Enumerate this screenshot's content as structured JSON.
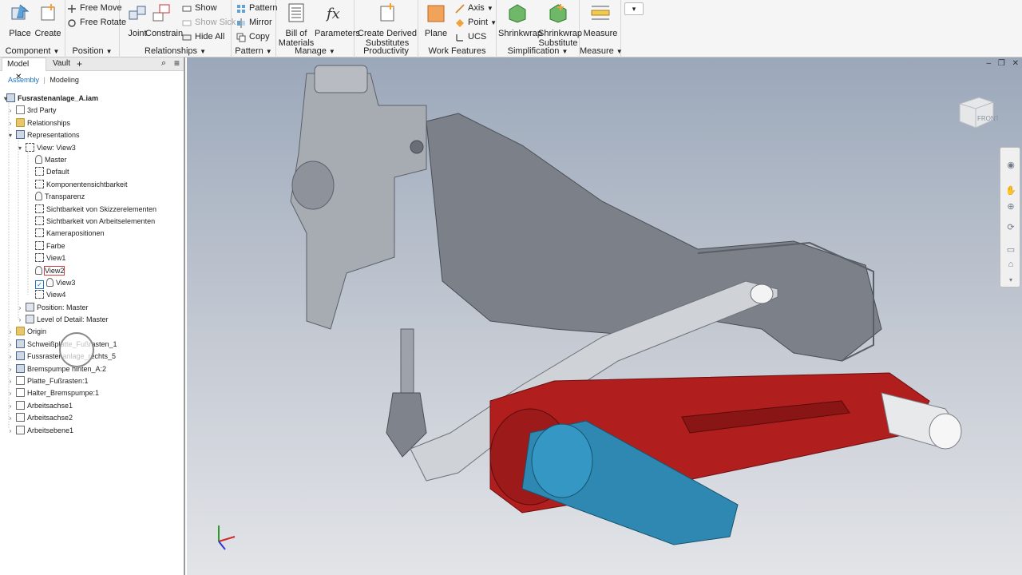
{
  "ribbon": {
    "groups": {
      "component": {
        "label": "Component",
        "place": "Place",
        "create": "Create"
      },
      "position": {
        "label": "Position",
        "free_move": "Free Move",
        "free_rotate": "Free Rotate"
      },
      "relationships": {
        "label": "Relationships",
        "joint": "Joint",
        "constrain": "Constrain",
        "show": "Show",
        "show_sick": "Show Sick",
        "hide_all": "Hide All"
      },
      "pattern": {
        "label": "Pattern",
        "pattern": "Pattern",
        "mirror": "Mirror",
        "copy": "Copy"
      },
      "manage": {
        "label": "Manage",
        "bill_of_materials_1": "Bill of",
        "bill_of_materials_2": "Materials",
        "parameters": "Parameters"
      },
      "productivity": {
        "label": "Productivity",
        "create_derived_1": "Create Derived",
        "create_derived_2": "Substitutes"
      },
      "work_features": {
        "label": "Work Features",
        "plane": "Plane",
        "axis": "Axis",
        "point": "Point",
        "ucs": "UCS"
      },
      "simplification": {
        "label": "Simplification",
        "shrinkwrap": "Shrinkwrap",
        "shrinkwrap_sub_1": "Shrinkwrap",
        "shrinkwrap_sub_2": "Substitute"
      },
      "measure": {
        "label": "Measure",
        "measure": "Measure"
      }
    }
  },
  "browser": {
    "tabs": {
      "model": "Model",
      "vault": "Vault"
    },
    "subtabs": {
      "assembly": "Assembly",
      "modeling": "Modeling"
    },
    "tree": [
      {
        "label": "Fusrastenanlage_A.iam"
      },
      {
        "label": "3rd Party"
      },
      {
        "label": "Relationships"
      },
      {
        "label": "Representations"
      },
      {
        "label": "View: View3"
      },
      {
        "label": "Master"
      },
      {
        "label": "Default"
      },
      {
        "label": "Komponentensichtbarkeit"
      },
      {
        "label": "Transparenz"
      },
      {
        "label": "Sichtbarkeit von Skizzerelementen"
      },
      {
        "label": "Sichtbarkeit von Arbeitselementen"
      },
      {
        "label": "Kamerapositionen"
      },
      {
        "label": "Farbe"
      },
      {
        "label": "View1"
      },
      {
        "label": "View2"
      },
      {
        "label": "View3"
      },
      {
        "label": "View4"
      },
      {
        "label": "Position: Master"
      },
      {
        "label": "Level of Detail: Master"
      },
      {
        "label": "Origin"
      },
      {
        "label": "Schweißplatte_Fußrasten_1"
      },
      {
        "label": "Fussrastenanlage_rechts_5"
      },
      {
        "label": "Bremspumpe hinten_A:2"
      },
      {
        "label": "Platte_Fußrasten:1"
      },
      {
        "label": "Halter_Bremspumpe:1"
      },
      {
        "label": "Arbeitsachse1"
      },
      {
        "label": "Arbeitsachse2"
      },
      {
        "label": "Arbeitsebene1"
      }
    ]
  },
  "viewport": {
    "viewcube_face": "FRONT",
    "accent_red": "#b01e1e",
    "accent_blue": "#2f88b2"
  }
}
